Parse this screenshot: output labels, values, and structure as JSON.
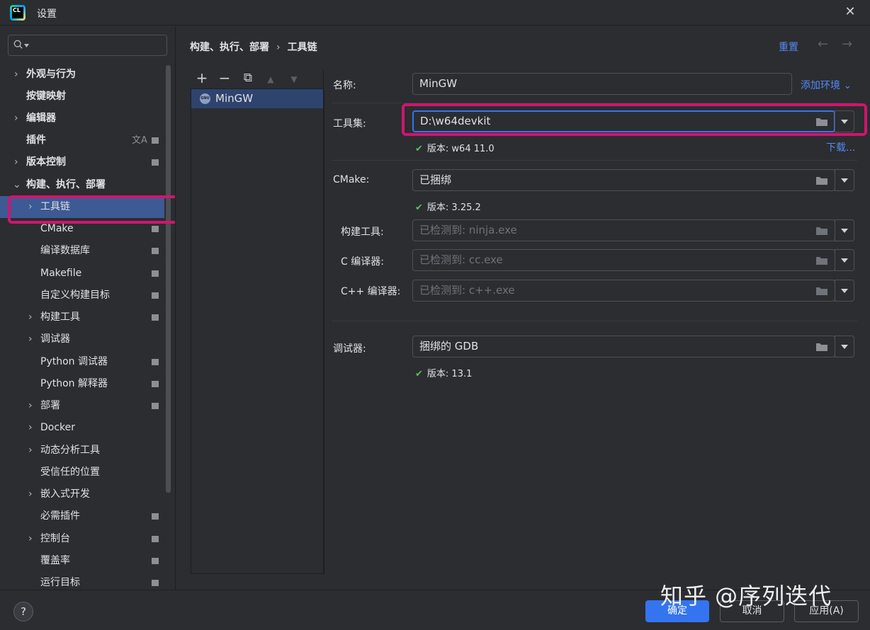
{
  "window": {
    "title": "设置",
    "app_icon": "clion-logo",
    "app_icon_text": "CL"
  },
  "sidebar": {
    "search_placeholder": "",
    "items": [
      {
        "label": "外观与行为",
        "level": 0,
        "expandable": true,
        "bold": true
      },
      {
        "label": "按键映射",
        "level": 0,
        "expandable": false,
        "bold": true
      },
      {
        "label": "编辑器",
        "level": 0,
        "expandable": true,
        "bold": true
      },
      {
        "label": "插件",
        "level": 0,
        "expandable": false,
        "bold": true,
        "icons": [
          "translate-icon",
          "project-scope-icon"
        ]
      },
      {
        "label": "版本控制",
        "level": 0,
        "expandable": true,
        "bold": true,
        "icons": [
          "project-scope-icon"
        ]
      },
      {
        "label": "构建、执行、部署",
        "level": 0,
        "expandable": true,
        "expanded": true,
        "bold": true
      },
      {
        "label": "工具链",
        "level": 1,
        "expandable": true,
        "selected": true
      },
      {
        "label": "CMake",
        "level": 1,
        "icons": [
          "project-scope-icon"
        ]
      },
      {
        "label": "编译数据库",
        "level": 1,
        "icons": [
          "project-scope-icon"
        ]
      },
      {
        "label": "Makefile",
        "level": 1,
        "icons": [
          "project-scope-icon"
        ]
      },
      {
        "label": "自定义构建目标",
        "level": 1,
        "icons": [
          "project-scope-icon"
        ]
      },
      {
        "label": "构建工具",
        "level": 1,
        "expandable": true,
        "icons": [
          "project-scope-icon"
        ]
      },
      {
        "label": "调试器",
        "level": 1,
        "expandable": true
      },
      {
        "label": "Python 调试器",
        "level": 1,
        "icons": [
          "project-scope-icon"
        ]
      },
      {
        "label": "Python 解释器",
        "level": 1,
        "icons": [
          "project-scope-icon"
        ]
      },
      {
        "label": "部署",
        "level": 1,
        "expandable": true,
        "icons": [
          "project-scope-icon"
        ]
      },
      {
        "label": "Docker",
        "level": 1,
        "expandable": true
      },
      {
        "label": "动态分析工具",
        "level": 1,
        "expandable": true
      },
      {
        "label": "受信任的位置",
        "level": 1
      },
      {
        "label": "嵌入式开发",
        "level": 1,
        "expandable": true
      },
      {
        "label": "必需插件",
        "level": 1,
        "icons": [
          "project-scope-icon"
        ]
      },
      {
        "label": "控制台",
        "level": 1,
        "expandable": true,
        "icons": [
          "project-scope-icon"
        ]
      },
      {
        "label": "覆盖率",
        "level": 1,
        "icons": [
          "project-scope-icon"
        ]
      },
      {
        "label": "运行目标",
        "level": 1,
        "icons": [
          "project-scope-icon"
        ]
      }
    ]
  },
  "breadcrumb": {
    "parent": "构建、执行、部署",
    "separator": "›",
    "current": "工具链"
  },
  "header": {
    "reset": "重置",
    "back": "←",
    "forward": "→"
  },
  "toolchains": {
    "toolbar": {
      "add": "+",
      "remove": "−",
      "copy": "⧉",
      "up": "▲",
      "down": "▼"
    },
    "items": [
      {
        "label": "MinGW",
        "icon": "gnu-icon",
        "icon_text": "GNU"
      }
    ]
  },
  "form": {
    "name_label": "名称:",
    "name_value": "MinGW",
    "add_env": "添加环境 ⌄",
    "toolset_label": "工具集:",
    "toolset_value": "D:\\w64devkit",
    "toolset_status": "版本: w64 11.0",
    "download": "下载...",
    "cmake_label": "CMake:",
    "cmake_value": "已捆绑",
    "cmake_status": "版本: 3.25.2",
    "build_tool_label": "构建工具:",
    "build_tool_placeholder": "已检测到: ninja.exe",
    "c_compiler_label": "C 编译器:",
    "c_compiler_placeholder": "已检测到: cc.exe",
    "cpp_compiler_label": "C++ 编译器:",
    "cpp_compiler_placeholder": "已检测到: c++.exe",
    "debugger_label": "调试器:",
    "debugger_value": "捆绑的 GDB",
    "debugger_status": "版本: 13.1",
    "status_check": "✔"
  },
  "footer": {
    "help": "?",
    "ok": "确定",
    "cancel": "取消",
    "apply": "应用(A)"
  },
  "watermark": "知乎 @序列迭代",
  "colors": {
    "accent": "#3574f0",
    "highlight": "#d0156f",
    "success": "#5fb865",
    "link": "#548af7"
  }
}
